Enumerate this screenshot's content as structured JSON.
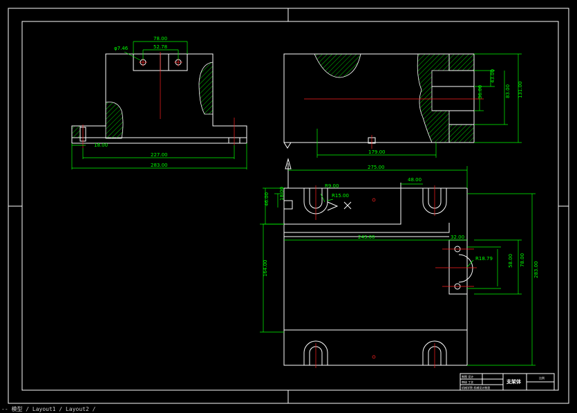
{
  "drawing": {
    "colors": {
      "background": "#000000",
      "outline": "#ffffff",
      "dimension": "#00ff00",
      "centerline": "#ff2020"
    },
    "front_view_dims": {
      "d1": "φ7.46",
      "d2": "78.00",
      "d3": "52.78",
      "d4": "18.00",
      "d5": "227.00",
      "d6": "283.00"
    },
    "side_view_dims": {
      "d1": "43.00",
      "d2": "36.00",
      "d3": "83.00",
      "d4": "131.00",
      "d5": "179.00"
    },
    "top_view_dims": {
      "d1": "275.00",
      "d2": "R9.00",
      "d3": "R15.00",
      "d4": "48.00",
      "d5": "18.00",
      "d6": "46.00",
      "d7": "243.00",
      "d8": "32.00",
      "d9": "R18.79",
      "d10": "58.00",
      "d11": "78.00",
      "d12": "283.00",
      "d13": "164.00"
    },
    "axis_label": "X",
    "title_block": {
      "part_name": "支架体",
      "row1": "制图 设计",
      "row2": "审核 工艺",
      "row3": "机械学院 机械设计制造",
      "cell": "比例"
    },
    "command_line": "-- 模型 / Layout1 / Layout2 /"
  }
}
